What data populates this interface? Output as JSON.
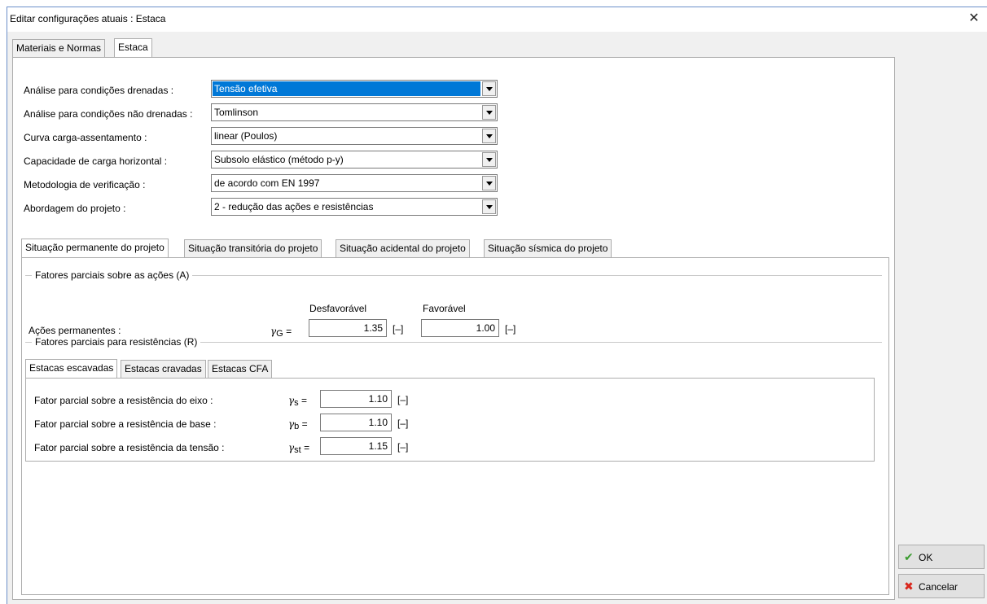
{
  "window": {
    "title": "Editar configurações atuais : Estaca",
    "close_glyph": "✕"
  },
  "main_tabs": [
    {
      "label": "Materiais e Normas"
    },
    {
      "label": "Estaca"
    }
  ],
  "settings": [
    {
      "label": "Análise para condições drenadas :",
      "value": "Tensão efetiva"
    },
    {
      "label": "Análise para condições não drenadas :",
      "value": "Tomlinson"
    },
    {
      "label": "Curva carga-assentamento :",
      "value": "linear (Poulos)"
    },
    {
      "label": "Capacidade de carga horizontal :",
      "value": "Subsolo elástico (método p-y)"
    },
    {
      "label": "Metodologia de verificação :",
      "value": "de acordo com EN 1997"
    },
    {
      "label": "Abordagem do projeto :",
      "value": "2 - redução das ações e resistências"
    }
  ],
  "situation_tabs": [
    {
      "label": "Situação permanente do projeto"
    },
    {
      "label": "Situação transitória do projeto"
    },
    {
      "label": "Situação acidental do projeto"
    },
    {
      "label": "Situação sísmica do projeto"
    }
  ],
  "actions_group": {
    "title": "Fatores parciais sobre as ações (A)",
    "col_unfavorable": "Desfavorável",
    "col_favorable": "Favorável",
    "row_label": "Ações permanentes :",
    "symbol": "γ",
    "symbol_sub": "G",
    "eq": "=",
    "unfavorable_value": "1.35",
    "favorable_value": "1.00",
    "unit": "[–]"
  },
  "resistances_group": {
    "title": "Fatores parciais para resistências (R)",
    "tabs": [
      {
        "label": "Estacas escavadas"
      },
      {
        "label": "Estacas cravadas"
      },
      {
        "label": "Estacas CFA"
      }
    ],
    "rows": [
      {
        "label": "Fator parcial sobre a resistência do eixo :",
        "symbol": "γ",
        "sub": "s",
        "eq": "=",
        "value": "1.10",
        "unit": "[–]"
      },
      {
        "label": "Fator parcial sobre a resistência de base :",
        "symbol": "γ",
        "sub": "b",
        "eq": "=",
        "value": "1.10",
        "unit": "[–]"
      },
      {
        "label": "Fator parcial sobre a resistência da tensão :",
        "symbol": "γ",
        "sub": "st",
        "eq": "=",
        "value": "1.15",
        "unit": "[–]"
      }
    ]
  },
  "buttons": {
    "ok": {
      "label": "OK",
      "icon": "✔",
      "color": "#3a9c2f"
    },
    "cancel": {
      "label": "Cancelar",
      "icon": "✖",
      "color": "#d9261c"
    }
  }
}
